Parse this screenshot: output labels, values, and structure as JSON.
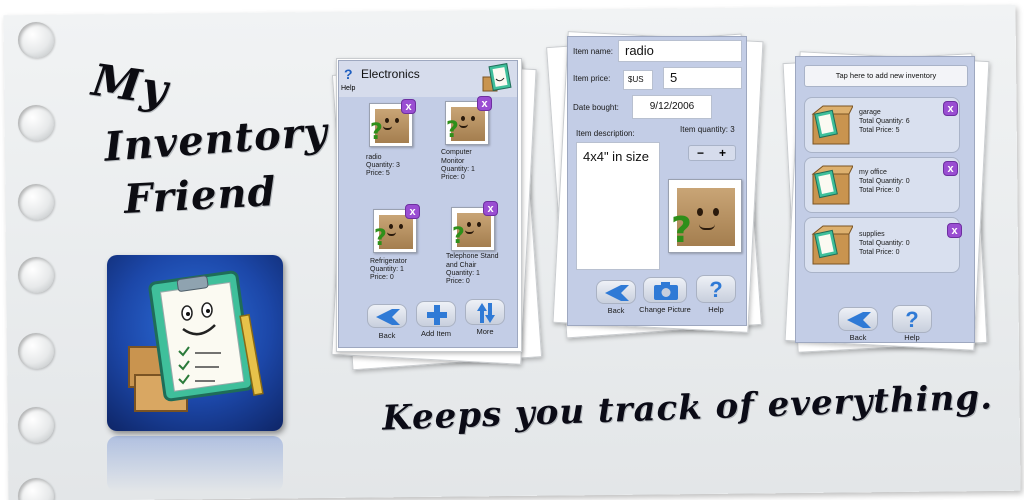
{
  "brand": {
    "title_lines": [
      "My",
      "Inventory",
      "Friend"
    ],
    "tagline": "Keeps you track of everything.",
    "app_icon": "clipboard-box-mascot-icon"
  },
  "screen1": {
    "category_title": "Electronics",
    "help_label": "Help",
    "items": [
      {
        "name": "radio",
        "quantity": "Quantity: 3",
        "price": "Price: 5"
      },
      {
        "name": "Computer\nMonitor",
        "quantity": "Quantity: 1",
        "price": "Price: 0"
      },
      {
        "name": "Refrigerator",
        "quantity": "Quantity: 1",
        "price": "Price: 0"
      },
      {
        "name": "Telephone Stand\nand Chair",
        "quantity": "Quantity: 1",
        "price": "Price: 0"
      }
    ],
    "buttons": {
      "back": "Back",
      "add": "Add Item",
      "more": "More"
    }
  },
  "screen2": {
    "labels": {
      "name": "Item name:",
      "price": "Item price:",
      "date": "Date bought:",
      "description": "Item description:",
      "quantity": "Item quantity: 3"
    },
    "values": {
      "name": "radio",
      "currency": "$US",
      "price": "5",
      "date": "9/12/2006",
      "description": "4x4\" in size"
    },
    "stepper": {
      "minus": "−",
      "plus": "+"
    },
    "buttons": {
      "back": "Back",
      "change_picture": "Change Picture",
      "help": "Help"
    }
  },
  "screen3": {
    "add_label": "Tap here to add new inventory",
    "inventories": [
      {
        "name": "garage",
        "total_quantity": "Total Quantity: 6",
        "total_price": "Total Price: 5"
      },
      {
        "name": "my office",
        "total_quantity": "Total Quantity: 0",
        "total_price": "Total Price: 0"
      },
      {
        "name": "supplies",
        "total_quantity": "Total Quantity: 0",
        "total_price": "Total Price: 0"
      }
    ],
    "buttons": {
      "back": "Back",
      "help": "Help"
    }
  },
  "colors": {
    "accent_blue": "#2f7ad6",
    "delete_purple": "#9a4ed2",
    "phone_bg": "#c3cde6"
  }
}
